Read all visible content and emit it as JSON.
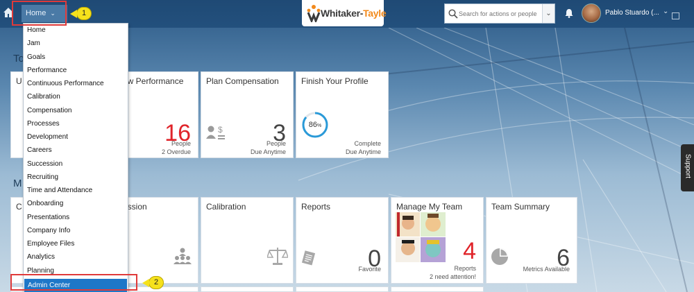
{
  "topbar": {
    "home_menu_label": "Home",
    "logo_text_main": "Whitaker-",
    "logo_text_tail": "Tayle",
    "search_placeholder": "Search for actions or people",
    "user_name": "Pablo Stuardo (..."
  },
  "callouts": [
    "1",
    "2"
  ],
  "sections": {
    "to_do_label": "To",
    "my_label": "M"
  },
  "menu": {
    "items": [
      "Home",
      "Jam",
      "Goals",
      "Performance",
      "Continuous Performance",
      "Calibration",
      "Compensation",
      "Processes",
      "Development",
      "Careers",
      "Succession",
      "Recruiting",
      "Time and Attendance",
      "Onboarding",
      "Presentations",
      "Company Info",
      "Employee Files",
      "Analytics",
      "Planning",
      "Admin Center"
    ],
    "selected": "Admin Center"
  },
  "tiles_row1": [
    {
      "title": "U",
      "big": "",
      "sub1": "",
      "sub2": ""
    },
    {
      "title": "ew Performance",
      "big": "16",
      "sub1": "People",
      "sub2": "2 Overdue",
      "big_color": "#e0242a"
    },
    {
      "title": "Plan Compensation",
      "big": "3",
      "sub1": "People",
      "sub2": "Due Anytime"
    },
    {
      "title": "Finish Your Profile",
      "ring_value": "86",
      "ring_unit": "%",
      "sub1": "Complete",
      "sub2": "Due Anytime"
    }
  ],
  "tiles_row2": [
    {
      "title": "C"
    },
    {
      "title": "ession"
    },
    {
      "title": "Calibration"
    },
    {
      "title": "Reports",
      "big": "0",
      "sub1": "Favorite"
    },
    {
      "title": "Manage My Team",
      "big": "4",
      "sub1": "Reports",
      "sub2": "2 need attention!",
      "big_color": "#e0242a"
    },
    {
      "title": "Team Summary",
      "big": "6",
      "sub1": "Metrics Available"
    }
  ],
  "support_label": "Support",
  "colors": {
    "shell": "#23507d",
    "selected_menu": "#1e77c8",
    "alert_red": "#e0242a",
    "callout": "#f5e11c",
    "progress_ring": "#2a9ad8"
  },
  "icons": [
    "home-icon",
    "chevron-down-icon",
    "search-icon",
    "bell-icon",
    "avatar",
    "screen-icon",
    "people-icon",
    "compensation-icon",
    "scale-icon",
    "report-icon",
    "pie-chart-icon",
    "team-photos"
  ]
}
